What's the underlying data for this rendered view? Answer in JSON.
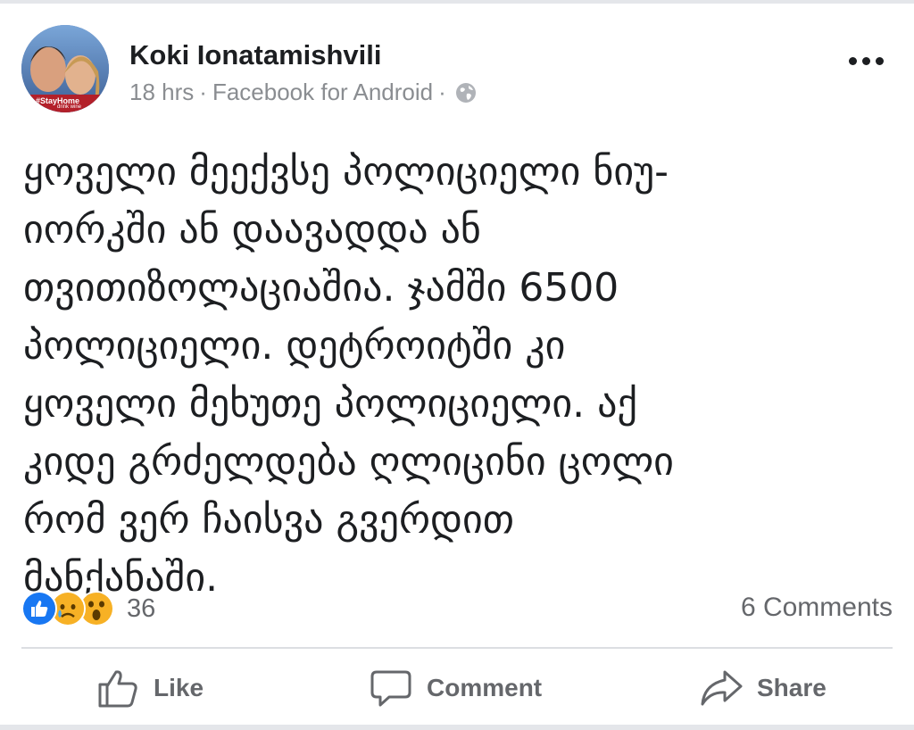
{
  "post": {
    "author": {
      "name": "Koki Ionatamishvili"
    },
    "avatar": {
      "badge_text": "#StayHome",
      "badge_subtext": "drink wine"
    },
    "meta": {
      "time": "18 hrs",
      "separator": "·",
      "source": "Facebook for Android",
      "privacy_icon": "globe-icon"
    },
    "more_icon": "more-options-icon",
    "text_lines": [
      "ყოველი მეექვსე პოლიციელი ნიუ-",
      "იორკში ან დაავადდა ან",
      "თვითიზოლაციაშია. ჯამში 6500",
      "პოლიციელი. დეტროიტში კი",
      "ყოველი მეხუთე პოლიციელი. აქ",
      "კიდე გრძელდება ღლიცინი ცოლი",
      "რომ ვერ ჩაისვა გვერდით",
      "მანქანაში."
    ]
  },
  "stats": {
    "reactions": [
      "like-reaction-icon",
      "sad-reaction-icon",
      "wow-reaction-icon"
    ],
    "reaction_count": "36",
    "comments_label": "6 Comments"
  },
  "actions": {
    "like": {
      "label": "Like",
      "icon": "thumbs-up-icon"
    },
    "comment": {
      "label": "Comment",
      "icon": "speech-bubble-icon"
    },
    "share": {
      "label": "Share",
      "icon": "share-arrow-icon"
    }
  },
  "colors": {
    "text": "#1c1e21",
    "secondary": "#65676b",
    "meta": "#8a8d91",
    "like_blue": "#1877f2",
    "emoji_yellow": "#f7b125",
    "divider": "#dcdee2"
  }
}
